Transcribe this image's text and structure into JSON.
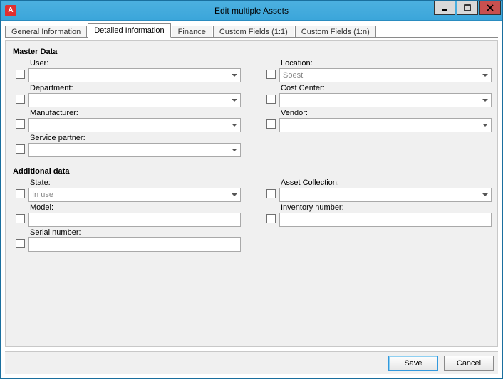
{
  "window": {
    "app_icon_letter": "A",
    "title": "Edit multiple Assets"
  },
  "tabs": [
    {
      "label": "General Information",
      "active": false
    },
    {
      "label": "Detailed Information",
      "active": true
    },
    {
      "label": "Finance",
      "active": false
    },
    {
      "label": "Custom Fields (1:1)",
      "active": false
    },
    {
      "label": "Custom Fields (1:n)",
      "active": false
    }
  ],
  "sections": {
    "master": {
      "title": "Master Data",
      "left": [
        {
          "key": "user",
          "label": "User:",
          "type": "combo",
          "value": "",
          "checked": false
        },
        {
          "key": "department",
          "label": "Department:",
          "type": "combo",
          "value": "",
          "checked": false
        },
        {
          "key": "manufacturer",
          "label": "Manufacturer:",
          "type": "combo",
          "value": "",
          "checked": false
        },
        {
          "key": "service_partner",
          "label": "Service partner:",
          "type": "combo",
          "value": "",
          "checked": false
        }
      ],
      "right": [
        {
          "key": "location",
          "label": "Location:",
          "type": "combo",
          "value": "Soest",
          "checked": false
        },
        {
          "key": "cost_center",
          "label": "Cost Center:",
          "type": "combo",
          "value": "",
          "checked": false
        },
        {
          "key": "vendor",
          "label": "Vendor:",
          "type": "combo",
          "value": "",
          "checked": false
        }
      ]
    },
    "additional": {
      "title": "Additional data",
      "left": [
        {
          "key": "state",
          "label": "State:",
          "type": "combo",
          "value": "In use",
          "checked": false
        },
        {
          "key": "model",
          "label": "Model:",
          "type": "text",
          "value": "",
          "checked": false
        },
        {
          "key": "serial_number",
          "label": "Serial number:",
          "type": "text",
          "value": "",
          "checked": false
        }
      ],
      "right": [
        {
          "key": "asset_collection",
          "label": "Asset Collection:",
          "type": "combo",
          "value": "",
          "checked": false
        },
        {
          "key": "inventory_number",
          "label": "Inventory number:",
          "type": "text",
          "value": "",
          "checked": false
        }
      ]
    }
  },
  "buttons": {
    "save": "Save",
    "cancel": "Cancel"
  }
}
